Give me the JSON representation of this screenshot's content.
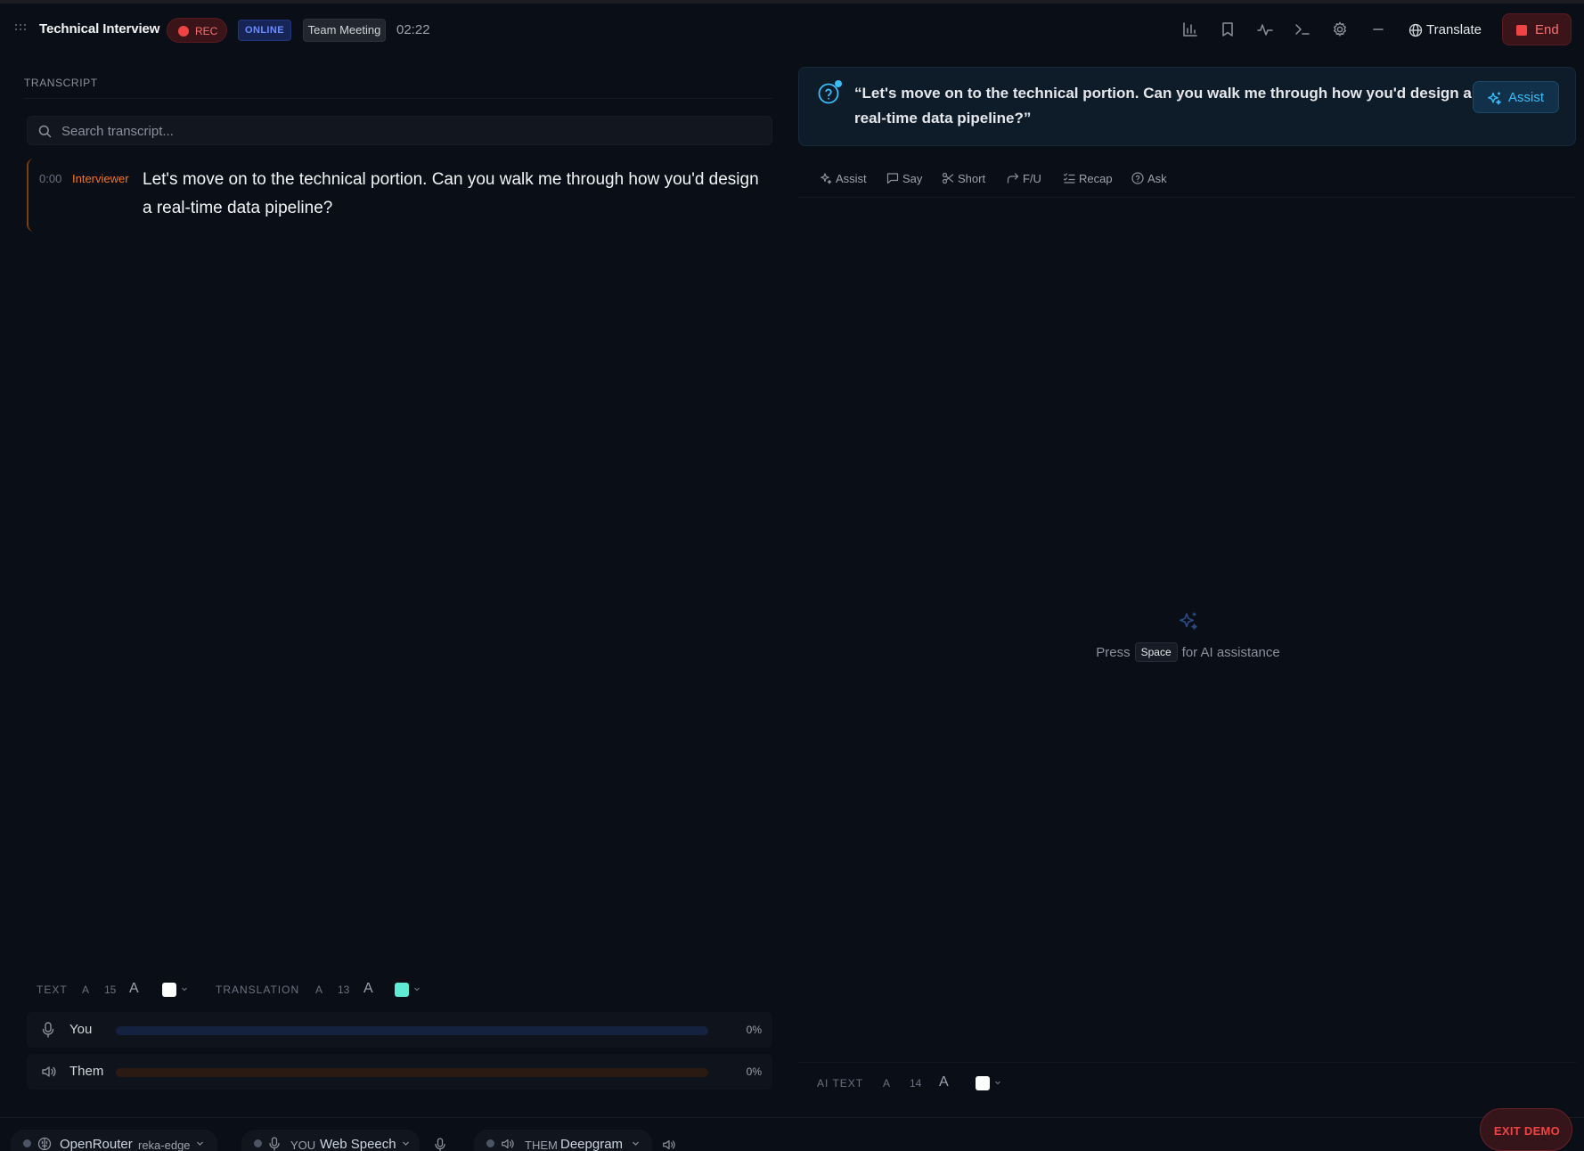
{
  "colors": {
    "background": "#0a0e17",
    "rec_red": "#ef4444",
    "online_blue": "#6b8cff",
    "speaker_orange": "#f97316",
    "assist_cyan": "#38bdf8",
    "you_bar": "#14213f",
    "them_bar": "#2b1a12",
    "text_swatch": "#ffffff",
    "translation_swatch": "#5eead4",
    "ai_text_swatch": "#ffffff"
  },
  "header": {
    "title": "Technical Interview",
    "rec_label": "REC",
    "online_label": "ONLINE",
    "meeting_type": "Team Meeting",
    "timer": "02:22",
    "icons": [
      "drag-handle-icon",
      "chart-icon",
      "bookmark-icon",
      "activity-icon",
      "terminal-icon",
      "gear-icon",
      "minimize-icon",
      "globe-icon"
    ],
    "translate_label": "Translate",
    "end_label": "End"
  },
  "transcript": {
    "header": "TRANSCRIPT",
    "search_placeholder": "Search transcript...",
    "entries": [
      {
        "time": "0:00",
        "speaker": "Interviewer",
        "text": "Let's move on to the technical portion. Can you walk me through how you'd design a real-time data pipeline?"
      }
    ]
  },
  "text_controls": {
    "text_label": "TEXT",
    "text_small": "A",
    "text_size": "15",
    "text_large": "A",
    "translation_label": "TRANSLATION",
    "translation_small": "A",
    "translation_size": "13",
    "translation_large": "A"
  },
  "levels": [
    {
      "name": "You",
      "percent_label": "0%",
      "level": 0
    },
    {
      "name": "Them",
      "percent_label": "0%",
      "level": 0
    }
  ],
  "assist_panel": {
    "question": "“Let's move on to the technical portion. Can you walk me through how you'd design a real-time data pipeline?”",
    "assist_button": "Assist",
    "actions": [
      {
        "label": "Assist",
        "icon": "sparkle-icon"
      },
      {
        "label": "Say",
        "icon": "chat-icon"
      },
      {
        "label": "Short",
        "icon": "scissors-icon"
      },
      {
        "label": "F/U",
        "icon": "forward-icon"
      },
      {
        "label": "Recap",
        "icon": "list-check-icon"
      },
      {
        "label": "Ask",
        "icon": "help-circle-icon"
      }
    ],
    "empty_prefix": "Press",
    "empty_key": "Space",
    "empty_suffix": "for AI assistance"
  },
  "ai_text_controls": {
    "label": "AI TEXT",
    "small": "A",
    "size": "14",
    "large": "A"
  },
  "status_bar": {
    "provider": "OpenRouter",
    "model": "reka-edge",
    "you_label": "YOU",
    "you_engine": "Web Speech",
    "them_label": "THEM",
    "them_engine": "Deepgram",
    "exit_label": "EXIT DEMO"
  }
}
